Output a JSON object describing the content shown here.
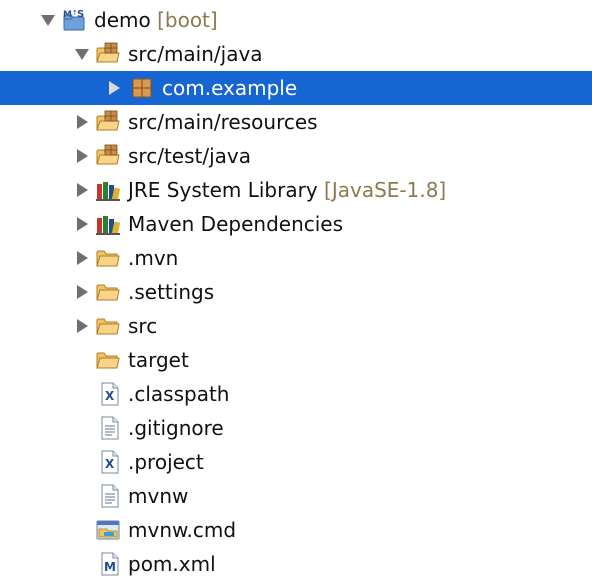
{
  "tree": {
    "items": [
      {
        "label": "demo",
        "decoration": "[boot]",
        "icon": "maven-project-icon",
        "expanded": true
      },
      {
        "label": "src/main/java",
        "icon": "source-folder-icon",
        "expanded": true
      },
      {
        "label": "com.example",
        "icon": "package-icon",
        "expanded": false,
        "selected": true
      },
      {
        "label": "src/main/resources",
        "icon": "source-folder-icon",
        "expanded": false
      },
      {
        "label": "src/test/java",
        "icon": "source-folder-icon",
        "expanded": false
      },
      {
        "label": "JRE System Library",
        "decoration": "[JavaSE-1.8]",
        "icon": "library-icon",
        "expanded": false
      },
      {
        "label": "Maven Dependencies",
        "icon": "library-icon",
        "expanded": false
      },
      {
        "label": ".mvn",
        "icon": "folder-icon",
        "expanded": false
      },
      {
        "label": ".settings",
        "icon": "folder-icon",
        "expanded": false
      },
      {
        "label": "src",
        "icon": "folder-icon",
        "expanded": false
      },
      {
        "label": "target",
        "icon": "folder-icon"
      },
      {
        "label": ".classpath",
        "icon": "xml-file-icon"
      },
      {
        "label": ".gitignore",
        "icon": "text-file-icon"
      },
      {
        "label": ".project",
        "icon": "xml-file-icon"
      },
      {
        "label": "mvnw",
        "icon": "text-file-icon"
      },
      {
        "label": "mvnw.cmd",
        "icon": "cmd-file-icon"
      },
      {
        "label": "pom.xml",
        "icon": "maven-pom-icon"
      }
    ]
  },
  "colors": {
    "selection": "#1565d3",
    "decoration": "#8b7a4f",
    "folder": "#e8b04a"
  }
}
